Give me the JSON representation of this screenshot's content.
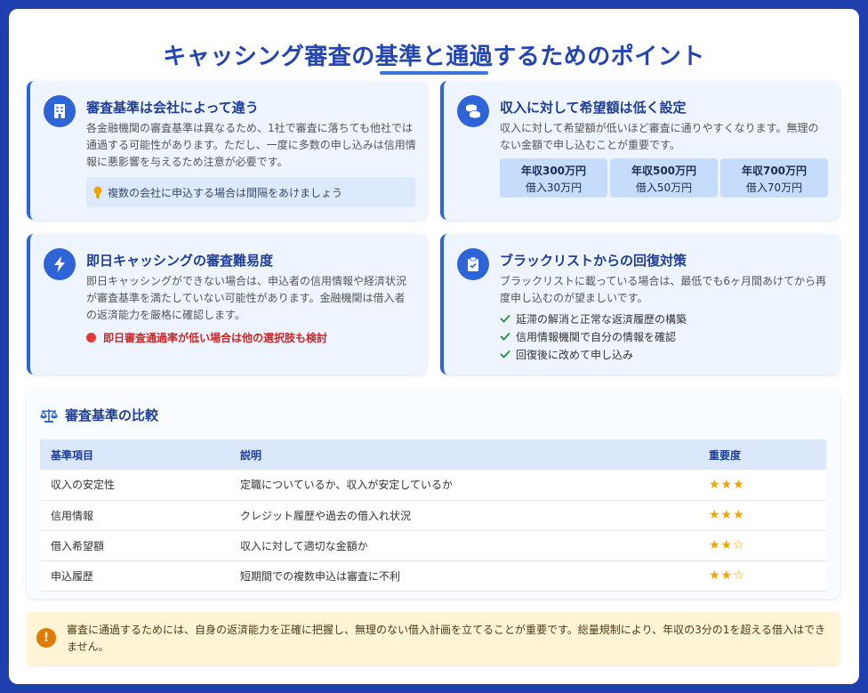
{
  "header": {
    "title": "キャッシング審査の基準と通過するためのポイント"
  },
  "cards": {
    "criteria": {
      "icon": "building-icon",
      "title": "審査基準は会社によって違う",
      "text": "各金融機関の審査基準は異なるため、1社で審査に落ちても他社では通過する可能性があります。ただし、一度に多数の申し込みは信用情報に悪影響を与えるため注意が必要です。",
      "tip_icon": "lightbulb-icon",
      "tip": "複数の会社に申込する場合は間隔をあけましょう"
    },
    "income": {
      "icon": "coins-icon",
      "title": "収入に対して希望額は低く設定",
      "text": "収入に対して希望額が低いほど審査に通りやすくなります。無理のない金額で申し込むことが重要です。",
      "examples": [
        {
          "income": "年収300万円",
          "loan": "借入30万円"
        },
        {
          "income": "年収500万円",
          "loan": "借入50万円"
        },
        {
          "income": "年収700万円",
          "loan": "借入70万円"
        }
      ]
    },
    "sameday": {
      "icon": "lightning-icon",
      "title": "即日キャッシングの審査難易度",
      "text": "即日キャッシングができない場合は、申込者の信用情報や経済状況が審査基準を満たしていない可能性があります。金融機関は借入者の返済能力を厳格に確認します。",
      "warning": "即日審査通過率が低い場合は他の選択肢も検討"
    },
    "blacklist": {
      "icon": "clipboard-icon",
      "title": "ブラックリストからの回復対策",
      "text": "ブラックリストに載っている場合は、最低でも6ヶ月間あけてから再度申し込むのが望ましいです。",
      "checks": [
        "延滞の解消と正常な返済履歴の構築",
        "信用情報機関で自分の情報を確認",
        "回復後に改めて申し込み"
      ]
    }
  },
  "comparison": {
    "icon": "scale-icon",
    "title": "審査基準の比較",
    "headers": [
      "基準項目",
      "説明",
      "重要度"
    ],
    "rows": [
      {
        "item": "収入の安定性",
        "desc": "定職についているか、収入が安定しているか",
        "stars": "★★★"
      },
      {
        "item": "信用情報",
        "desc": "クレジット履歴や過去の借入れ状況",
        "stars": "★★★"
      },
      {
        "item": "借入希望額",
        "desc": "収入に対して適切な金額か",
        "stars": "★★☆"
      },
      {
        "item": "申込履歴",
        "desc": "短期間での複数申込は審査に不利",
        "stars": "★★☆"
      }
    ]
  },
  "notice": {
    "icon": "exclamation-icon",
    "mark": "!",
    "text": "審査に通過するためには、自身の返済能力を正確に把握し、無理のない借入計画を立てることが重要です。総量規制により、年収の3分の1を超える借入はできません。"
  },
  "colors": {
    "primary": "#2f64d6",
    "title": "#2546b0",
    "warning": "#e53935",
    "star": "#f2a500",
    "notice_bg": "#fff5d6"
  }
}
